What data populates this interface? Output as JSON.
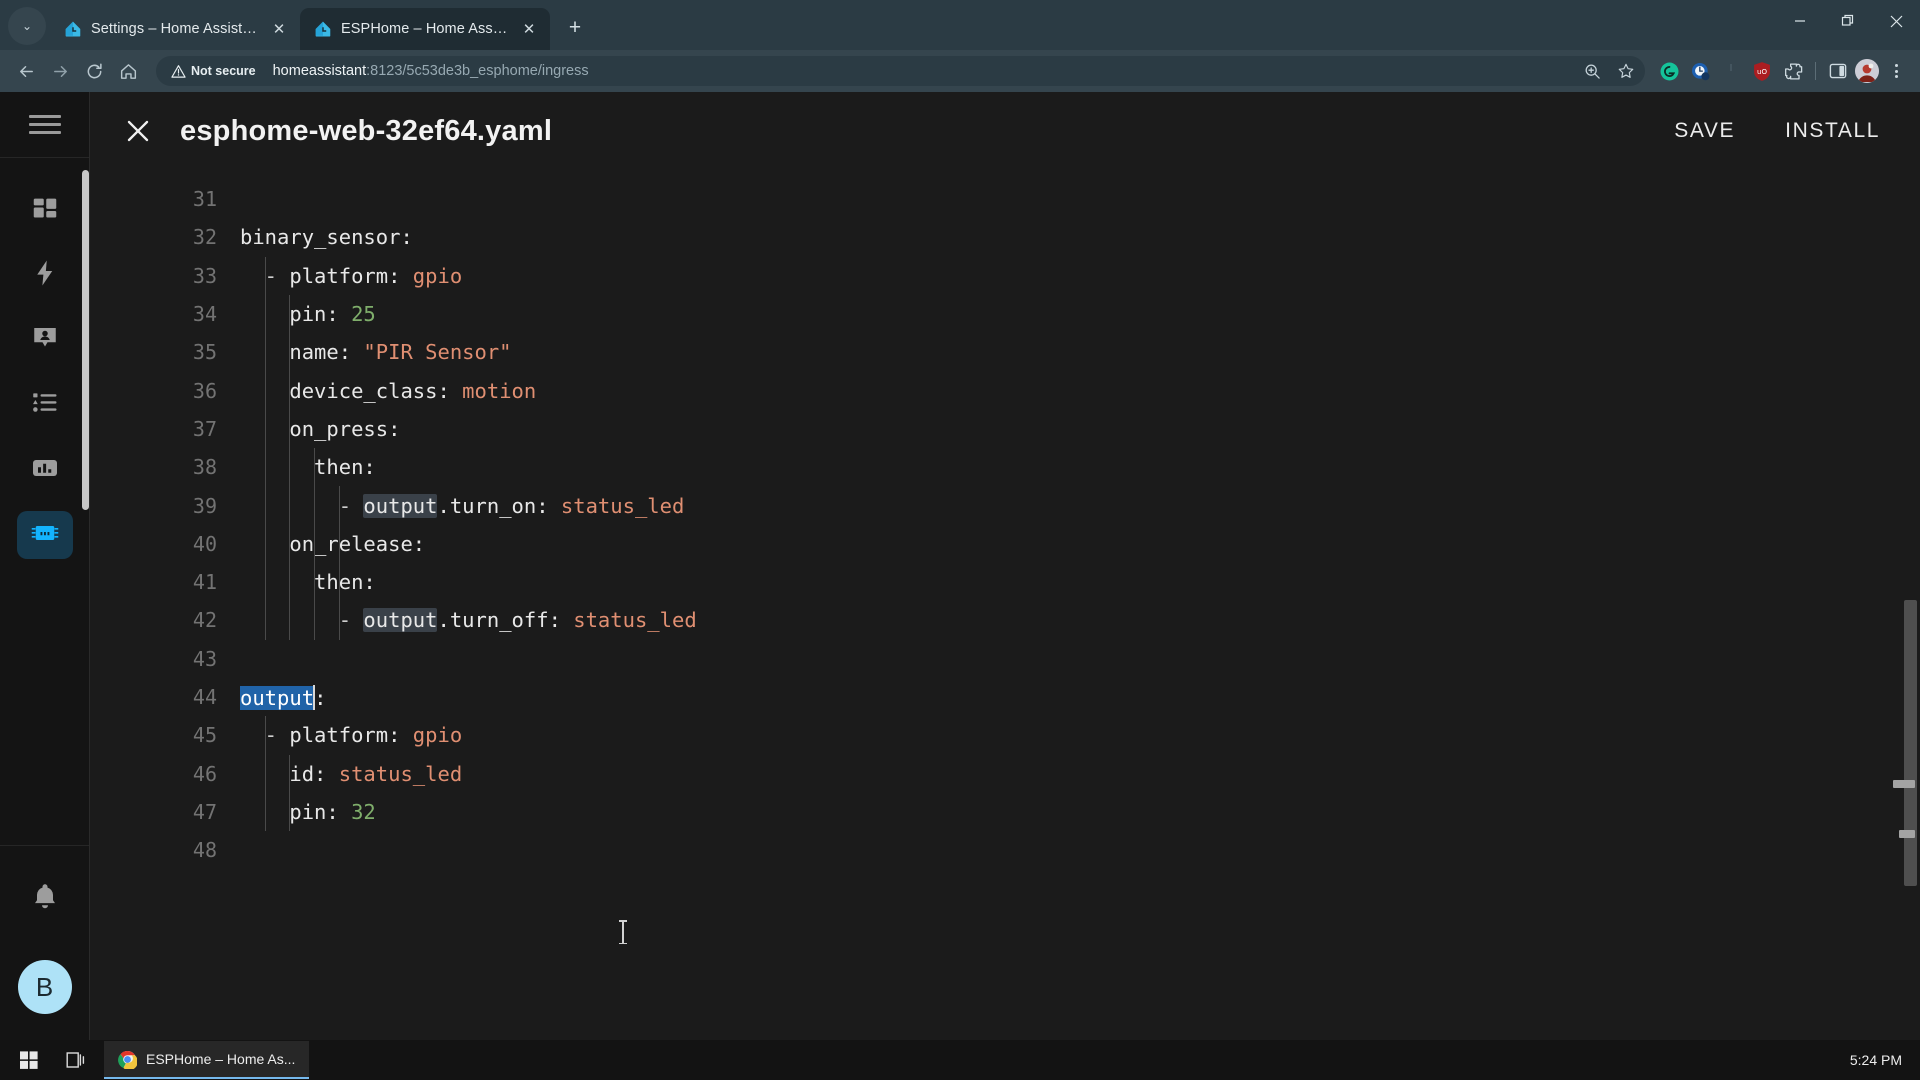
{
  "browser": {
    "tabs": [
      {
        "title": "Settings – Home Assistant",
        "favicon": "home-assistant-logo",
        "active": false
      },
      {
        "title": "ESPHome – Home Assistant",
        "favicon": "home-assistant-logo",
        "active": true
      }
    ],
    "new_tab_label": "+",
    "tabstrip_chevron": "⌄",
    "window_controls": {
      "minimize": "─",
      "restore": "❐",
      "close": "✕"
    },
    "nav": {
      "back": "←",
      "forward": "→",
      "reload": "↻",
      "home": "home-icon"
    },
    "omnibox": {
      "security_label": "Not secure",
      "security_icon": "warning-triangle-icon",
      "url_host": "homeassistant",
      "url_rest": ":8123/5c53de3b_esphome/ingress",
      "zoom_icon": "zoom-magnifier-icon",
      "bookmark_icon": "star-icon"
    },
    "extensions": [
      {
        "name": "grammarly-extension-icon",
        "color": "#15c39a",
        "glyph": "G"
      },
      {
        "name": "clock-extension-icon",
        "color": "#1a6fd4",
        "glyph": "◔"
      },
      {
        "name": "ublock-origin-icon",
        "color": "#a32222",
        "glyph": "uO"
      },
      {
        "name": "extensions-puzzle-icon",
        "color": "#cfdbe1",
        "glyph": "⧉"
      },
      {
        "name": "side-panel-icon",
        "color": "#cfdbe1",
        "glyph": "◧"
      }
    ],
    "profile_avatar": "user-avatar-photo",
    "menu_icon": "three-dot-menu-icon"
  },
  "sidebar": {
    "hamburger_icon": "hamburger-menu-icon",
    "items": [
      {
        "name": "overview",
        "icon": "dashboard-grid-icon",
        "active": false
      },
      {
        "name": "energy",
        "icon": "lightning-bolt-icon",
        "active": false
      },
      {
        "name": "map",
        "icon": "person-pin-icon",
        "active": false
      },
      {
        "name": "logbook",
        "icon": "logbook-list-icon",
        "active": false
      },
      {
        "name": "history",
        "icon": "bar-chart-icon",
        "active": false
      },
      {
        "name": "esphome",
        "icon": "chip-icon",
        "active": true
      }
    ],
    "notifications_icon": "bell-icon",
    "user_initial": "B",
    "active_color": "#13b4ff",
    "active_bg": "#16394d",
    "avatar_bg": "#aee2f7"
  },
  "app_header": {
    "close_icon": "close-x-icon",
    "title": "esphome-web-32ef64.yaml",
    "save_label": "SAVE",
    "install_label": "INSTALL"
  },
  "editor": {
    "first_line_number": 31,
    "cursor_line": 44,
    "selection_text": "output",
    "theme": {
      "background": "#1b1b1b",
      "text": "#e6e6e6",
      "line_number": "#737373",
      "value": "#e08f72",
      "string": "#e08f72",
      "number": "#7fae6b",
      "selection": "#2063a8",
      "occurrence": "#3a4149",
      "indent_guide": "#4a4a4a"
    },
    "lines": [
      {
        "n": 31,
        "indent": 0,
        "tokens": []
      },
      {
        "n": 32,
        "indent": 0,
        "tokens": [
          {
            "t": "binary_sensor:",
            "c": "tok-key"
          }
        ]
      },
      {
        "n": 33,
        "indent": 1,
        "tokens": [
          {
            "t": "  - ",
            "c": "tok-dash"
          },
          {
            "t": "platform: ",
            "c": "tok-key"
          },
          {
            "t": "gpio",
            "c": "tok-val"
          }
        ]
      },
      {
        "n": 34,
        "indent": 2,
        "tokens": [
          {
            "t": "    pin: ",
            "c": "tok-key"
          },
          {
            "t": "25",
            "c": "tok-num"
          }
        ]
      },
      {
        "n": 35,
        "indent": 2,
        "tokens": [
          {
            "t": "    name: ",
            "c": "tok-key"
          },
          {
            "t": "\"PIR Sensor\"",
            "c": "tok-str"
          }
        ]
      },
      {
        "n": 36,
        "indent": 2,
        "tokens": [
          {
            "t": "    device_class: ",
            "c": "tok-key"
          },
          {
            "t": "motion",
            "c": "tok-val"
          }
        ]
      },
      {
        "n": 37,
        "indent": 2,
        "tokens": [
          {
            "t": "    on_press:",
            "c": "tok-key"
          }
        ]
      },
      {
        "n": 38,
        "indent": 3,
        "tokens": [
          {
            "t": "      then:",
            "c": "tok-key"
          }
        ]
      },
      {
        "n": 39,
        "indent": 4,
        "tokens": [
          {
            "t": "        - ",
            "c": "tok-dash"
          },
          {
            "t": "output",
            "c": "tok-key occ"
          },
          {
            "t": ".turn_on: ",
            "c": "tok-key"
          },
          {
            "t": "status_led",
            "c": "tok-val"
          }
        ]
      },
      {
        "n": 40,
        "indent": 2,
        "tokens": [
          {
            "t": "    on_release:",
            "c": "tok-key"
          }
        ]
      },
      {
        "n": 41,
        "indent": 3,
        "tokens": [
          {
            "t": "      then:",
            "c": "tok-key"
          }
        ]
      },
      {
        "n": 42,
        "indent": 4,
        "tokens": [
          {
            "t": "        - ",
            "c": "tok-dash"
          },
          {
            "t": "output",
            "c": "tok-key occ"
          },
          {
            "t": ".turn_off: ",
            "c": "tok-key"
          },
          {
            "t": "status_led",
            "c": "tok-val"
          }
        ]
      },
      {
        "n": 43,
        "indent": 0,
        "tokens": []
      },
      {
        "n": 44,
        "indent": 0,
        "tokens": [
          {
            "t": "output",
            "c": "sel"
          },
          {
            "t": "CARET",
            "c": "caret"
          },
          {
            "t": ":",
            "c": "tok-punct"
          }
        ]
      },
      {
        "n": 45,
        "indent": 1,
        "tokens": [
          {
            "t": "  - ",
            "c": "tok-dash"
          },
          {
            "t": "platform: ",
            "c": "tok-key"
          },
          {
            "t": "gpio",
            "c": "tok-val"
          }
        ]
      },
      {
        "n": 46,
        "indent": 2,
        "tokens": [
          {
            "t": "    id: ",
            "c": "tok-key"
          },
          {
            "t": "status_led",
            "c": "tok-val"
          }
        ]
      },
      {
        "n": 47,
        "indent": 2,
        "tokens": [
          {
            "t": "    pin: ",
            "c": "tok-key"
          },
          {
            "t": "32",
            "c": "tok-num"
          }
        ]
      },
      {
        "n": 48,
        "indent": 0,
        "tokens": []
      }
    ]
  },
  "taskbar": {
    "start_icon": "windows-start-icon",
    "task_view_icon": "task-view-icon",
    "item_label": "ESPHome – Home As...",
    "item_icon": "chrome-icon",
    "clock": "5:24 PM"
  }
}
